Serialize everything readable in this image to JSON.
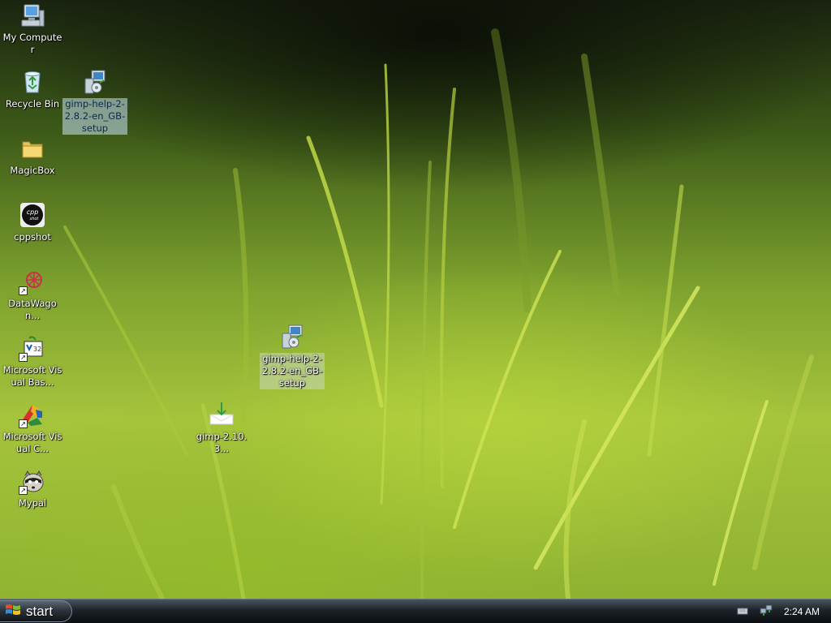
{
  "desktop": {
    "icons": [
      {
        "label": "My Computer",
        "icon": "computer-icon"
      },
      {
        "label": "Recycle Bin",
        "icon": "recycle-bin-icon"
      },
      {
        "label": "gimp-help-2-2.8.2-en_GB-setup",
        "icon": "installer-icon",
        "selected": true
      },
      {
        "label": "MagicBox",
        "icon": "folder-icon"
      },
      {
        "label": "cppshot",
        "icon": "cppshot-icon"
      },
      {
        "label": "DataWagon...",
        "icon": "datawagon-icon",
        "shortcut": true
      },
      {
        "label": "Microsoft Visual Bas...",
        "icon": "visual-basic-icon",
        "shortcut": true
      },
      {
        "label": "Microsoft Visual C...",
        "icon": "visual-c-icon",
        "shortcut": true
      },
      {
        "label": "Mypal",
        "icon": "mypal-icon",
        "shortcut": true
      },
      {
        "label": "gimp-help-2-2.8.2-en_GB-setup",
        "icon": "installer-icon",
        "selected": true
      },
      {
        "label": "gimp-2.10.3...",
        "icon": "download-icon"
      }
    ]
  },
  "taskbar": {
    "start_label": "start",
    "clock": "2:24 AM",
    "tray_icons": [
      "keyboard-icon",
      "network-icon"
    ]
  },
  "colors": {
    "taskbar": "#1d2329",
    "selection": "#c8e1f5",
    "grass": "#a6c43c"
  }
}
